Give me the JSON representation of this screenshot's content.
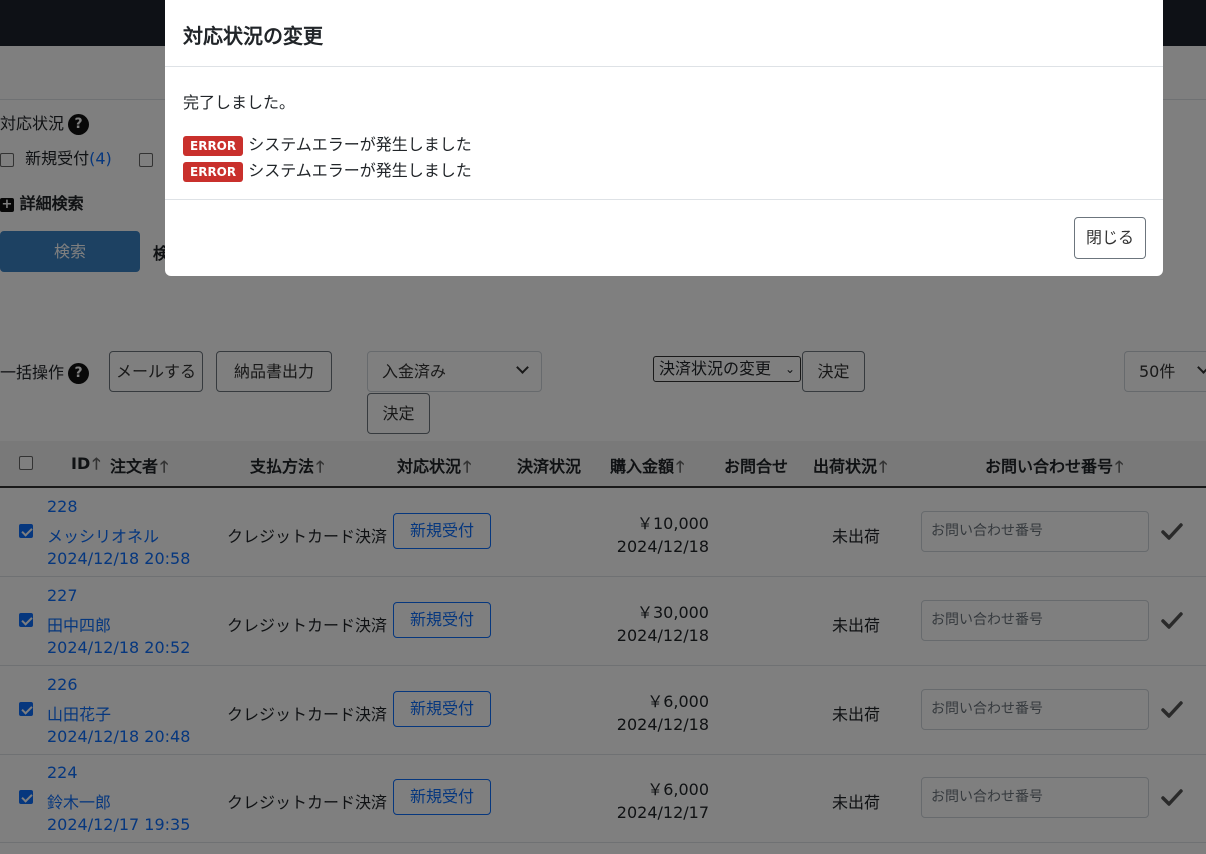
{
  "filters": {
    "status_label": "対応状況",
    "new_label": "新規受付",
    "new_count": "(4)",
    "advanced_search": "詳細検索",
    "search_button": "検索",
    "search_side_text": "検"
  },
  "bulk": {
    "label": "一括操作",
    "mail_button": "メールする",
    "delivery_button": "納品書出力",
    "payment_select_value": "入金済み",
    "decide_button": "決定",
    "settlement_select_value": "決済状況の変更",
    "decide_button2": "決定",
    "per_page_value": "50件"
  },
  "table": {
    "headers": {
      "id": "ID",
      "orderer": "注文者",
      "payment": "支払方法",
      "status": "対応状況",
      "settlement": "決済状況",
      "amount": "購入金額",
      "inquiry": "お問合せ",
      "shipping": "出荷状況",
      "inquiry_no": "お問い合わせ番号",
      "sort_arrow": "🡑"
    },
    "rows": [
      {
        "id": "228",
        "name": "メッシリオネル",
        "datetime": "2024/12/18 20:58",
        "payment": "クレジットカード決済",
        "status": "新規受付",
        "amount": "￥10,000",
        "date": "2024/12/18",
        "shipping": "未出荷",
        "inquiry_placeholder": "お問い合わせ番号"
      },
      {
        "id": "227",
        "name": "田中四郎",
        "datetime": "2024/12/18 20:52",
        "payment": "クレジットカード決済",
        "status": "新規受付",
        "amount": "￥30,000",
        "date": "2024/12/18",
        "shipping": "未出荷",
        "inquiry_placeholder": "お問い合わせ番号"
      },
      {
        "id": "226",
        "name": "山田花子",
        "datetime": "2024/12/18 20:48",
        "payment": "クレジットカード決済",
        "status": "新規受付",
        "amount": "￥6,000",
        "date": "2024/12/18",
        "shipping": "未出荷",
        "inquiry_placeholder": "お問い合わせ番号"
      },
      {
        "id": "224",
        "name": "鈴木一郎",
        "datetime": "2024/12/17 19:35",
        "payment": "クレジットカード決済",
        "status": "新規受付",
        "amount": "￥6,000",
        "date": "2024/12/17",
        "shipping": "未出荷",
        "inquiry_placeholder": "お問い合わせ番号"
      }
    ]
  },
  "modal": {
    "title": "対応状況の変更",
    "message": "完了しました。",
    "errors": [
      {
        "badge": "ERROR",
        "text": "システムエラーが発生しました"
      },
      {
        "badge": "ERROR",
        "text": "システムエラーが発生しました"
      }
    ],
    "close_button": "閉じる"
  }
}
